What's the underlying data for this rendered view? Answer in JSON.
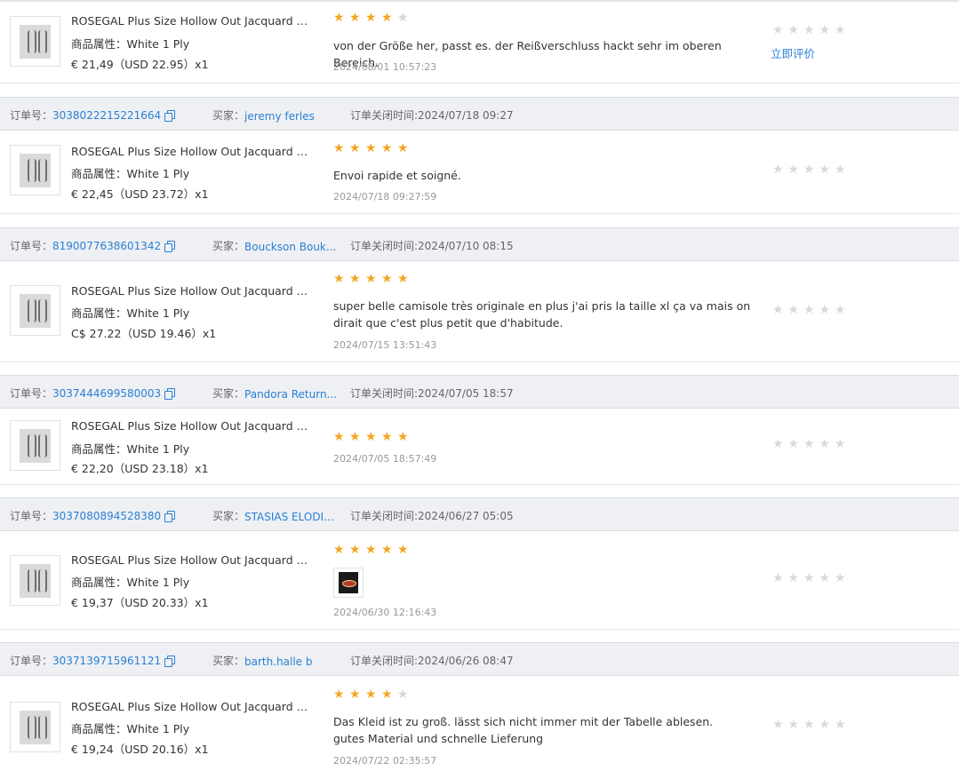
{
  "labels": {
    "order_no": "订单号：",
    "buyer": "买家：",
    "closed_time": "订单关闭时间:",
    "attr_prefix": "商品属性：",
    "rate_now": "立即评价"
  },
  "orders": [
    {
      "order_no": "",
      "buyer": "",
      "closed_time": "",
      "product_title": "ROSEGAL Plus Size Hollow Out Jacquard Tee...",
      "attr": "商品属性：White 1 Ply",
      "price": "€ 21,49（USD  22.95）x1",
      "rating": 4,
      "review_text": "von der Größe her, passt es. der Reißverschluss hackt sehr im oberen Bereich.",
      "review_time": "2024/08/01 10:57:23",
      "my_rating": 0,
      "action": "立即评价"
    },
    {
      "order_no": "3038022215221664",
      "buyer": "jeremy ferles",
      "closed_time": "订单关闭时间:2024/07/18 09:27",
      "product_title": "ROSEGAL Plus Size Hollow Out Jacquard Tee...",
      "attr": "商品属性：White 1 Ply",
      "price": "€ 22,45（USD  23.72）x1",
      "rating": 5,
      "review_text": "Envoi rapide et soigné.",
      "review_time": "2024/07/18 09:27:59",
      "my_rating": 0
    },
    {
      "order_no": "8190077638601342",
      "buyer": "Bouckson Bouk...",
      "closed_time": "订单关闭时间:2024/07/10 08:15",
      "product_title": "ROSEGAL Plus Size Hollow Out Jacquard Tee...",
      "attr": "商品属性：White 1 Ply",
      "price": "C$ 27.22（USD  19.46）x1",
      "rating": 5,
      "review_text": "super belle camisole très originale en plus j'ai pris la taille xl ça va mais on dirait que c'est plus petit que d'habitude.",
      "review_time": "2024/07/15 13:51:43",
      "my_rating": 0
    },
    {
      "order_no": "3037444699580003",
      "buyer": "Pandora Return...",
      "closed_time": "订单关闭时间:2024/07/05 18:57",
      "product_title": "ROSEGAL Plus Size Hollow Out Jacquard Tee...",
      "attr": "商品属性：White 1 Ply",
      "price": "€ 22,20（USD  23.18）x1",
      "rating": 5,
      "review_text": "",
      "review_time": "2024/07/05 18:57:49",
      "my_rating": 0
    },
    {
      "order_no": "3037080894528380",
      "buyer": "STASIAS ELODIE...",
      "closed_time": "订单关闭时间:2024/06/27 05:05",
      "product_title": "ROSEGAL Plus Size Hollow Out Jacquard Tee...",
      "attr": "商品属性：White 1 Ply",
      "price": "€ 19,37（USD  20.33）x1",
      "rating": 5,
      "review_text": "",
      "review_time": "2024/06/30 12:16:43",
      "has_image": true,
      "my_rating": 0
    },
    {
      "order_no": "3037139715961121",
      "buyer": "barth.halle b",
      "closed_time": "订单关闭时间:2024/06/26 08:47",
      "product_title": "ROSEGAL Plus Size Hollow Out Jacquard Tee...",
      "attr": "商品属性：White 1 Ply",
      "price": "€ 19,24（USD  20.16）x1",
      "rating": 4,
      "review_text": "Das Kleid ist zu groß. lässt sich nicht immer mit der Tabelle ablesen. gutes Material und schnelle Lieferung",
      "review_time": "2024/07/22 02:35:57",
      "my_rating": 0
    }
  ],
  "colors": {
    "accent": "#2a7fd4",
    "star_on": "#f5a623",
    "star_off": "#d6d6d6",
    "header_bg": "#eef0f3"
  }
}
